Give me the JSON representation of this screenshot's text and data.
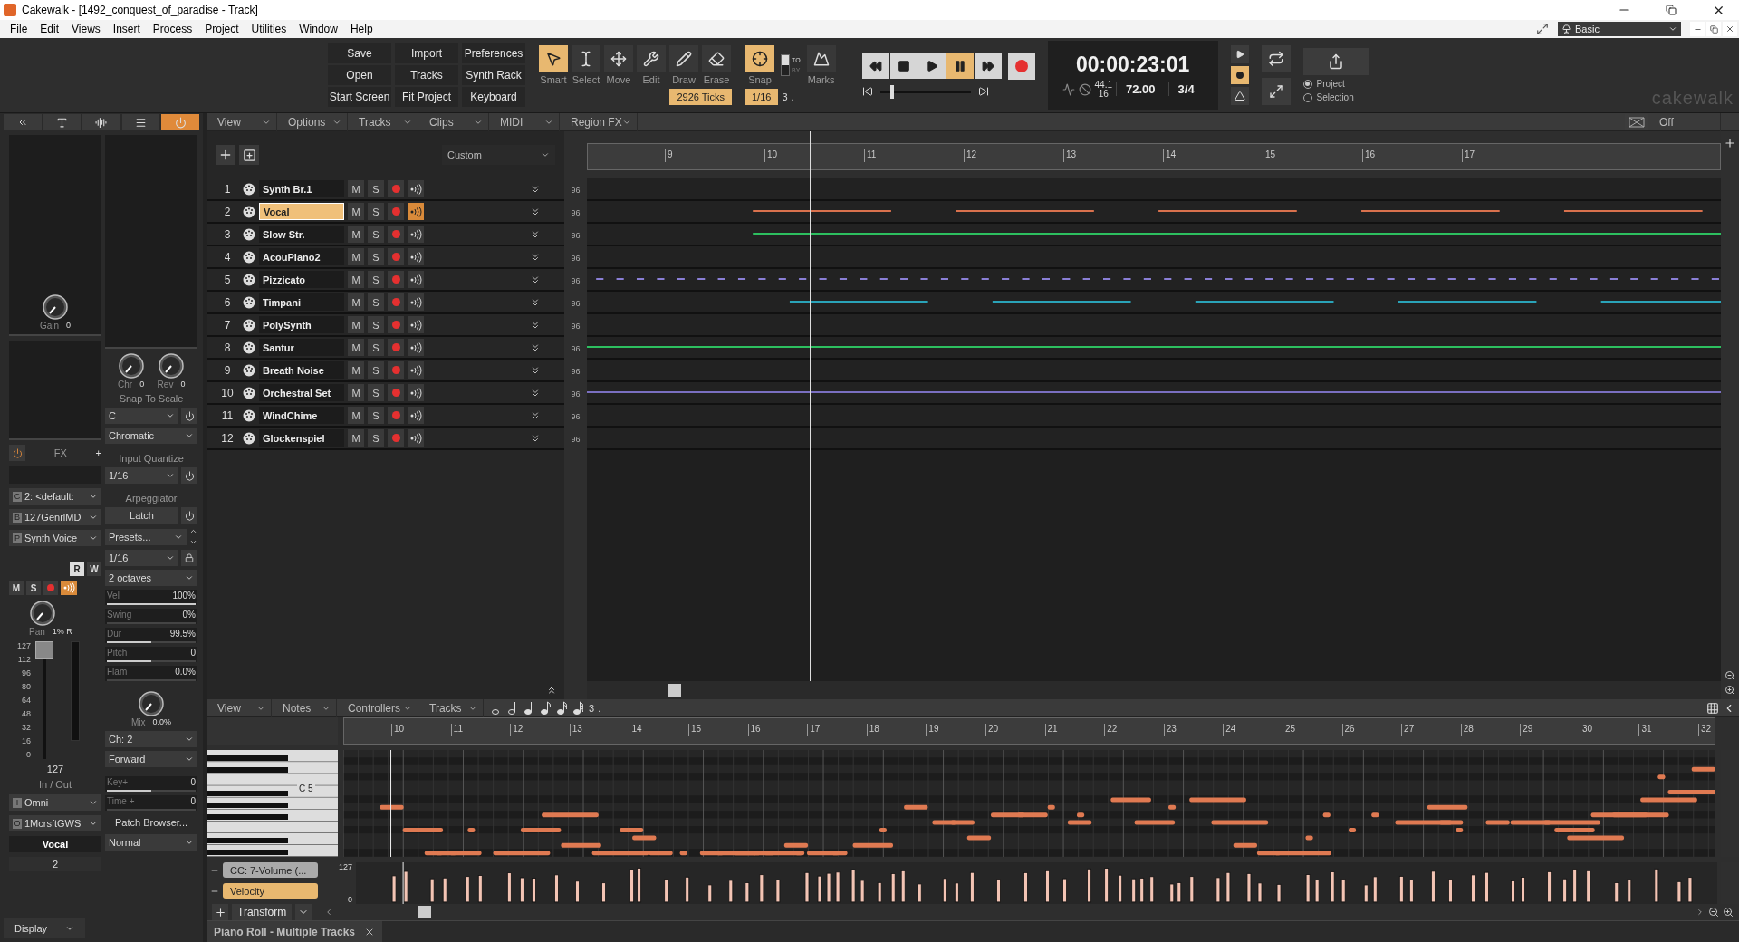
{
  "window": {
    "title": "Cakewalk - [1492_conquest_of_paradise - Track]"
  },
  "menu": [
    "File",
    "Edit",
    "Views",
    "Insert",
    "Process",
    "Project",
    "Utilities",
    "Window",
    "Help"
  ],
  "workspace": "Basic",
  "toolbar": {
    "buttons": [
      "Save",
      "Import",
      "Preferences",
      "Open",
      "Tracks",
      "Synth Rack",
      "Start Screen",
      "Fit Project",
      "Keyboard"
    ],
    "tools": [
      {
        "kind": "smart",
        "label": "Smart",
        "selected": true
      },
      {
        "kind": "select",
        "label": "Select",
        "selected": false
      },
      {
        "kind": "move",
        "label": "Move",
        "selected": false
      },
      {
        "kind": "edit",
        "label": "Edit",
        "selected": false
      },
      {
        "kind": "draw",
        "label": "Draw",
        "selected": false
      },
      {
        "kind": "erase",
        "label": "Erase",
        "selected": false
      }
    ],
    "nudge": "2926 Ticks",
    "snap": {
      "label": "Snap",
      "on": true,
      "mode": [
        {
          "label": "TO",
          "selected": true
        },
        {
          "label": "BY",
          "selected": false
        }
      ],
      "value": "1/16",
      "triplet": "3",
      "dotted": "."
    },
    "marks": "Marks",
    "transport": [
      {
        "kind": "rewind",
        "active": false
      },
      {
        "kind": "stop",
        "active": false
      },
      {
        "kind": "play",
        "active": false
      },
      {
        "kind": "pause",
        "active": true
      },
      {
        "kind": "forward",
        "active": false
      }
    ],
    "position": {
      "level": 0.12
    },
    "time": "00:00:23:01",
    "sample_rate": "44.1",
    "bit_depth": "16",
    "tempo": "72.00",
    "meter": "3/4",
    "record_mode_on": true,
    "export_scope": [
      {
        "label": "Project",
        "selected": true
      },
      {
        "label": "Selection",
        "selected": false
      }
    ],
    "logo": "cakewalk"
  },
  "inspector": {
    "tabs": [
      {
        "kind": "text",
        "selected": false
      },
      {
        "kind": "wave",
        "selected": false
      },
      {
        "kind": "list",
        "selected": false
      },
      {
        "kind": "power",
        "selected": true
      }
    ],
    "gain": {
      "label": "Gain",
      "value": "0"
    },
    "chorus": {
      "label": "Chr",
      "value": "0"
    },
    "reverb": {
      "label": "Rev",
      "value": "0"
    },
    "snap_to_scale": {
      "title": "Snap To Scale",
      "key": "C",
      "scale": "Chromatic"
    },
    "fx": {
      "label": "FX",
      "add": "+",
      "on": true
    },
    "input_quantize": {
      "title": "Input Quantize",
      "value": "1/16"
    },
    "patch": [
      {
        "badge": "C",
        "value": "2: <default:"
      },
      {
        "badge": "B",
        "value": "127GenrlMD"
      },
      {
        "badge": "P",
        "value": "Synth Voice"
      }
    ],
    "arpeggiator": {
      "title": "Arpeggiator",
      "latch": "Latch",
      "preset": "Presets...",
      "rate": "1/16",
      "range": "2 octaves",
      "params": [
        {
          "label": "Vel",
          "value": "100%",
          "level": 1
        },
        {
          "label": "Swing",
          "value": "0%",
          "level": 0
        },
        {
          "label": "Dur",
          "value": "99.5%",
          "level": 0.5
        },
        {
          "label": "Pitch",
          "value": "0",
          "level": 0.5
        },
        {
          "label": "Flam",
          "value": "0.0%",
          "level": 0
        }
      ],
      "mix": {
        "label": "Mix",
        "value": "0.0%"
      },
      "channel": "Ch: 2",
      "direction": "Forward"
    },
    "offsets": [
      {
        "label": "Key+",
        "value": "0",
        "level": 0.5
      },
      {
        "label": "Time +",
        "value": "0",
        "level": 0
      }
    ],
    "patch_browser": "Patch Browser...",
    "mode": "Normal",
    "strip": {
      "read": {
        "label": "R",
        "on": true
      },
      "write": {
        "label": "W",
        "on": false
      },
      "mute": "M",
      "solo": "S",
      "echo_on": true,
      "pan": {
        "label": "Pan",
        "value": "1% R"
      },
      "scale": [
        "127",
        "112",
        "96",
        "80",
        "64",
        "48",
        "32",
        "16",
        "0"
      ],
      "fader": {
        "level": 1
      },
      "volume": "127"
    },
    "io": {
      "title": "In / Out",
      "input": {
        "badge": "I",
        "value": "Omni"
      },
      "output": {
        "badge": "O",
        "value": "1McrsftGWS"
      }
    },
    "track_name": "Vocal",
    "track_number": "2",
    "display": "Display"
  },
  "track_view": {
    "menus": [
      "View",
      "Options",
      "Tracks",
      "Clips",
      "MIDI",
      "Region FX"
    ],
    "layout": "Custom",
    "crossfade": "Off",
    "ruler": [
      "9",
      "10",
      "11",
      "12",
      "13",
      "14",
      "15",
      "16",
      "17"
    ],
    "tracks": [
      {
        "number": "1",
        "name": "Synth Br.1",
        "mute": "M",
        "solo": "S",
        "volume": "96",
        "selected": false,
        "echo": false,
        "kind": "empty"
      },
      {
        "number": "2",
        "name": "Vocal",
        "mute": "M",
        "solo": "S",
        "volume": "96",
        "selected": true,
        "echo": true,
        "color": "#d9714d",
        "kind": "segments"
      },
      {
        "number": "3",
        "name": "Slow Str.",
        "mute": "M",
        "solo": "S",
        "volume": "96",
        "selected": false,
        "echo": false,
        "color": "#2dbf5f",
        "kind": "solid"
      },
      {
        "number": "4",
        "name": "AcouPiano2",
        "mute": "M",
        "solo": "S",
        "volume": "96",
        "selected": false,
        "echo": false,
        "kind": "empty"
      },
      {
        "number": "5",
        "name": "Pizzicato",
        "mute": "M",
        "solo": "S",
        "volume": "96",
        "selected": false,
        "echo": false,
        "color": "#8a7fd6",
        "kind": "dashed"
      },
      {
        "number": "6",
        "name": "Timpani",
        "mute": "M",
        "solo": "S",
        "volume": "96",
        "selected": false,
        "echo": false,
        "color": "#2aa3b8",
        "kind": "segments"
      },
      {
        "number": "7",
        "name": "PolySynth",
        "mute": "M",
        "solo": "S",
        "volume": "96",
        "selected": false,
        "echo": false,
        "kind": "empty"
      },
      {
        "number": "8",
        "name": "Santur",
        "mute": "M",
        "solo": "S",
        "volume": "96",
        "selected": false,
        "echo": false,
        "color": "#2dbf5f",
        "kind": "full"
      },
      {
        "number": "9",
        "name": "Breath Noise",
        "mute": "M",
        "solo": "S",
        "volume": "96",
        "selected": false,
        "echo": false,
        "kind": "empty"
      },
      {
        "number": "10",
        "name": "Orchestral Set",
        "mute": "M",
        "solo": "S",
        "volume": "96",
        "selected": false,
        "echo": false,
        "color": "#7a6fc0",
        "kind": "full"
      },
      {
        "number": "11",
        "name": "WindChime",
        "mute": "M",
        "solo": "S",
        "volume": "96",
        "selected": false,
        "echo": false,
        "kind": "empty"
      },
      {
        "number": "12",
        "name": "Glockenspiel",
        "mute": "M",
        "solo": "S",
        "volume": "96",
        "selected": false,
        "echo": false,
        "kind": "empty"
      }
    ]
  },
  "piano_roll": {
    "menus": [
      "View",
      "Notes",
      "Controllers",
      "Tracks"
    ],
    "durations": [
      {
        "kind": "whole"
      },
      {
        "kind": "half"
      },
      {
        "kind": "quarter"
      },
      {
        "kind": "eighth"
      },
      {
        "kind": "sixteenth"
      },
      {
        "kind": "thirtysecond"
      }
    ],
    "triplet": "3",
    "dotted": ".",
    "ruler": [
      "10",
      "11",
      "12",
      "13",
      "14",
      "15",
      "16",
      "17",
      "18",
      "19",
      "20",
      "21",
      "22",
      "23",
      "24",
      "25",
      "26",
      "27",
      "28",
      "29",
      "30",
      "31",
      "32"
    ],
    "key_label": "C 5",
    "lanes": [
      {
        "label": "CC: 7-Volume (...",
        "selected": false
      },
      {
        "label": "Velocity",
        "selected": true
      }
    ],
    "lane_max": "127",
    "lane_min": "0",
    "transform": "Transform",
    "tab": "Piano Roll - Multiple Tracks"
  }
}
